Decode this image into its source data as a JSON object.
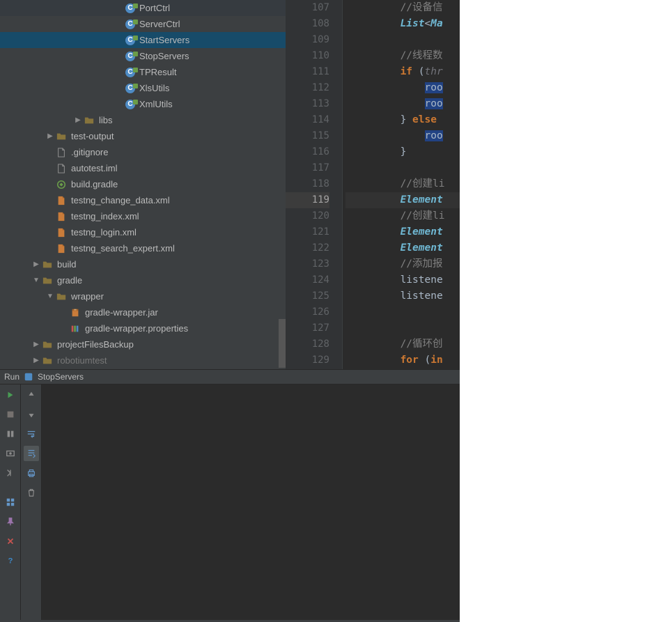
{
  "tree": {
    "items": [
      {
        "label": "PortCtrl",
        "depth": 5,
        "iconType": "class"
      },
      {
        "label": "ServerCtrl",
        "depth": 5,
        "iconType": "class"
      },
      {
        "label": "StartServers",
        "depth": 5,
        "iconType": "class",
        "selected": true
      },
      {
        "label": "StopServers",
        "depth": 5,
        "iconType": "class"
      },
      {
        "label": "TPResult",
        "depth": 5,
        "iconType": "class"
      },
      {
        "label": "XlsUtils",
        "depth": 5,
        "iconType": "class"
      },
      {
        "label": "XmlUtils",
        "depth": 5,
        "iconType": "class"
      },
      {
        "label": "libs",
        "depth": 4,
        "iconType": "folder",
        "arrow": "right"
      },
      {
        "label": "test-output",
        "depth": 2,
        "iconType": "folder",
        "arrow": "right"
      },
      {
        "label": ".gitignore",
        "depth": 2,
        "iconType": "plain"
      },
      {
        "label": "autotest.iml",
        "depth": 2,
        "iconType": "plain"
      },
      {
        "label": "build.gradle",
        "depth": 2,
        "iconType": "gradle"
      },
      {
        "label": "testng_change_data.xml",
        "depth": 2,
        "iconType": "xml"
      },
      {
        "label": "testng_index.xml",
        "depth": 2,
        "iconType": "xml"
      },
      {
        "label": "testng_login.xml",
        "depth": 2,
        "iconType": "xml"
      },
      {
        "label": "testng_search_expert.xml",
        "depth": 2,
        "iconType": "xml"
      },
      {
        "label": "build",
        "depth": 1,
        "iconType": "folder",
        "arrow": "right"
      },
      {
        "label": "gradle",
        "depth": 1,
        "iconType": "folder",
        "arrow": "down"
      },
      {
        "label": "wrapper",
        "depth": 2,
        "iconType": "folder",
        "arrow": "down"
      },
      {
        "label": "gradle-wrapper.jar",
        "depth": 3,
        "iconType": "jar"
      },
      {
        "label": "gradle-wrapper.properties",
        "depth": 3,
        "iconType": "props"
      },
      {
        "label": "projectFilesBackup",
        "depth": 1,
        "iconType": "folder",
        "arrow": "right"
      },
      {
        "label": "robotiumtest",
        "depth": 1,
        "iconType": "folder",
        "arrow": "right",
        "gray": true
      }
    ]
  },
  "editor": {
    "startLine": 107,
    "highlightedLine": 119,
    "lines": [
      {
        "num": 107,
        "tokens": [
          {
            "t": "         ",
            "c": ""
          },
          {
            "t": "//设备信",
            "c": "comment"
          }
        ]
      },
      {
        "num": 108,
        "tokens": [
          {
            "t": "         ",
            "c": ""
          },
          {
            "t": "List",
            "c": "type"
          },
          {
            "t": "<",
            "c": "text"
          },
          {
            "t": "Ma",
            "c": "type"
          }
        ]
      },
      {
        "num": 109,
        "tokens": []
      },
      {
        "num": 110,
        "tokens": [
          {
            "t": "         ",
            "c": ""
          },
          {
            "t": "//线程数",
            "c": "comment"
          }
        ]
      },
      {
        "num": 111,
        "tokens": [
          {
            "t": "         ",
            "c": ""
          },
          {
            "t": "if ",
            "c": "kw-plain"
          },
          {
            "t": "(",
            "c": "text"
          },
          {
            "t": "thr",
            "c": "param"
          }
        ]
      },
      {
        "num": 112,
        "tokens": [
          {
            "t": "             ",
            "c": ""
          },
          {
            "t": "roo",
            "c": "hl"
          }
        ]
      },
      {
        "num": 113,
        "tokens": [
          {
            "t": "             ",
            "c": ""
          },
          {
            "t": "roo",
            "c": "hl"
          }
        ]
      },
      {
        "num": 114,
        "tokens": [
          {
            "t": "         ",
            "c": ""
          },
          {
            "t": "} ",
            "c": "text"
          },
          {
            "t": "else",
            "c": "kw-plain"
          }
        ]
      },
      {
        "num": 115,
        "tokens": [
          {
            "t": "             ",
            "c": ""
          },
          {
            "t": "roo",
            "c": "hl"
          }
        ]
      },
      {
        "num": 116,
        "tokens": [
          {
            "t": "         ",
            "c": ""
          },
          {
            "t": "}",
            "c": "text"
          }
        ]
      },
      {
        "num": 117,
        "tokens": []
      },
      {
        "num": 118,
        "tokens": [
          {
            "t": "         ",
            "c": ""
          },
          {
            "t": "//创建li",
            "c": "comment"
          }
        ]
      },
      {
        "num": 119,
        "tokens": [
          {
            "t": "         ",
            "c": ""
          },
          {
            "t": "Element",
            "c": "type"
          }
        ]
      },
      {
        "num": 120,
        "tokens": [
          {
            "t": "         ",
            "c": ""
          },
          {
            "t": "//创建li",
            "c": "comment"
          }
        ]
      },
      {
        "num": 121,
        "tokens": [
          {
            "t": "         ",
            "c": ""
          },
          {
            "t": "Element",
            "c": "type"
          }
        ]
      },
      {
        "num": 122,
        "tokens": [
          {
            "t": "         ",
            "c": ""
          },
          {
            "t": "Element",
            "c": "type"
          }
        ]
      },
      {
        "num": 123,
        "tokens": [
          {
            "t": "         ",
            "c": ""
          },
          {
            "t": "//添加报",
            "c": "comment"
          }
        ]
      },
      {
        "num": 124,
        "tokens": [
          {
            "t": "         ",
            "c": ""
          },
          {
            "t": "listene",
            "c": "call"
          }
        ]
      },
      {
        "num": 125,
        "tokens": [
          {
            "t": "         ",
            "c": ""
          },
          {
            "t": "listene",
            "c": "call"
          }
        ]
      },
      {
        "num": 126,
        "tokens": []
      },
      {
        "num": 127,
        "tokens": []
      },
      {
        "num": 128,
        "tokens": [
          {
            "t": "         ",
            "c": ""
          },
          {
            "t": "//循环创",
            "c": "comment"
          }
        ]
      },
      {
        "num": 129,
        "tokens": [
          {
            "t": "         ",
            "c": ""
          },
          {
            "t": "for ",
            "c": "kw-plain"
          },
          {
            "t": "(",
            "c": "text"
          },
          {
            "t": "in",
            "c": "kw-plain"
          }
        ]
      }
    ]
  },
  "runPanel": {
    "label": "Run",
    "configName": "StopServers"
  }
}
